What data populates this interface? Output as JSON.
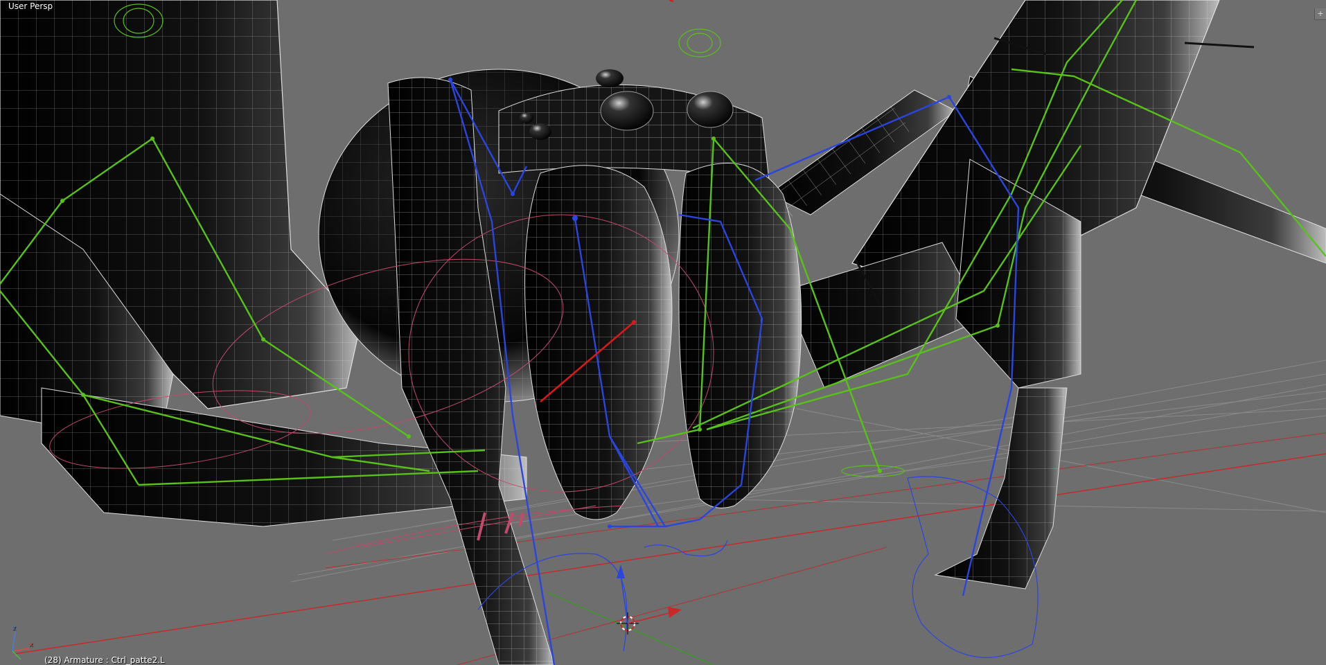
{
  "viewport": {
    "view_name": "User Persp",
    "status": "(28) Armature : Ctrl_patte2.L",
    "corner_button_icon": "plus-icon",
    "background_color": "#6e6e6e"
  },
  "orientation_gizmo": {
    "x_label": "x",
    "z_label": "z"
  },
  "colors": {
    "mesh_dark": "#0f0f0f",
    "wire": "#e8e8e8",
    "bone_green": "#58c21a",
    "bone_blue": "#2a45e0",
    "bone_selected_red": "#d81a1a",
    "curve_pink": "#c24a6a",
    "axis_x_red": "#c82828",
    "axis_y_green": "#3c9a28",
    "grid_line": "#8a8a8a"
  }
}
